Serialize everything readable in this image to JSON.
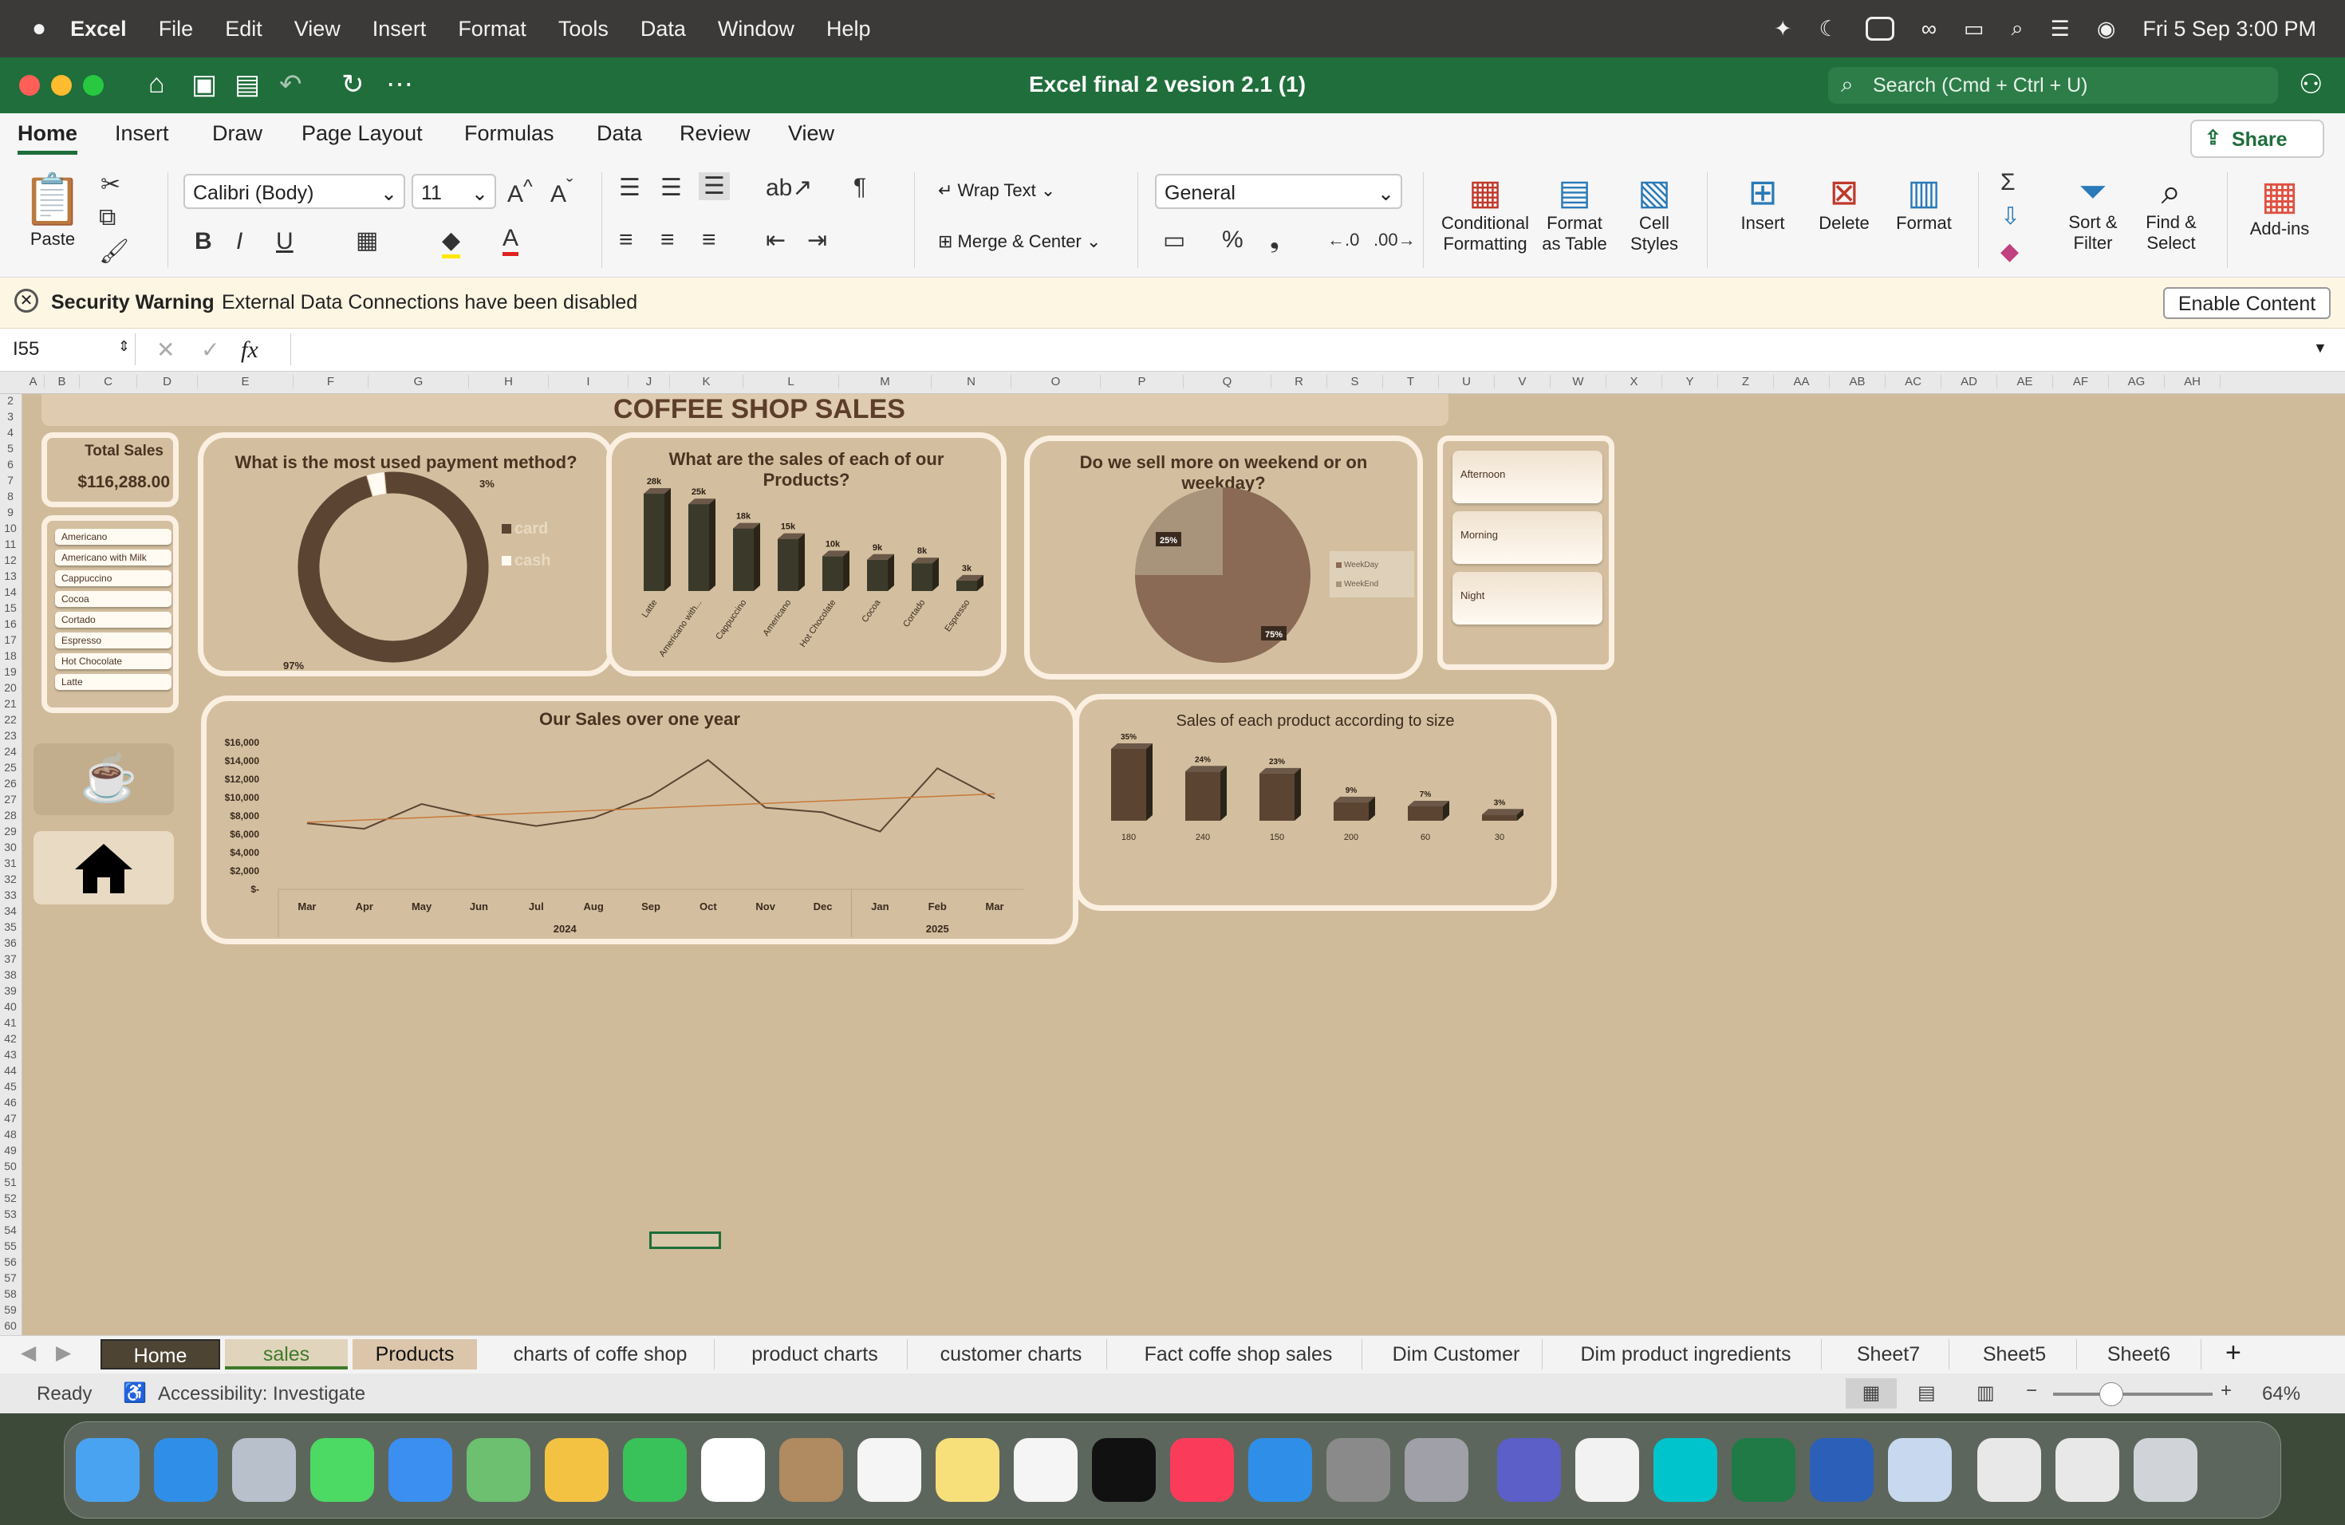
{
  "menubar": {
    "app": "Excel",
    "items": [
      "File",
      "Edit",
      "View",
      "Insert",
      "Format",
      "Tools",
      "Data",
      "Window",
      "Help"
    ],
    "datetime": "Fri 5 Sep  3:00 PM"
  },
  "window": {
    "title": "Excel final 2 vesion 2.1 (1)",
    "search_placeholder": "Search (Cmd + Ctrl + U)"
  },
  "ribbon": {
    "tabs": [
      "Home",
      "Insert",
      "Draw",
      "Page Layout",
      "Formulas",
      "Data",
      "Review",
      "View"
    ],
    "share": "Share",
    "paste": "Paste",
    "font_name": "Calibri (Body)",
    "font_size": "11",
    "wrap_text": "Wrap Text",
    "merge_center": "Merge & Center",
    "number_format": "General",
    "conditional": [
      "Conditional",
      "Formatting"
    ],
    "format_table": [
      "Format",
      "as Table"
    ],
    "cell_styles": [
      "Cell",
      "Styles"
    ],
    "insert": "Insert",
    "delete": "Delete",
    "format": "Format",
    "sort_filter": [
      "Sort &",
      "Filter"
    ],
    "find_select": [
      "Find &",
      "Select"
    ],
    "addins": "Add-ins"
  },
  "security": {
    "label": "Security Warning",
    "message": "External Data Connections have been disabled",
    "button": "Enable Content"
  },
  "formula_bar": {
    "cell_ref": "I55",
    "fx": "fx",
    "value": ""
  },
  "columns": [
    "A",
    "B",
    "C",
    "D",
    "E",
    "F",
    "G",
    "H",
    "I",
    "J",
    "K",
    "L",
    "M",
    "N",
    "O",
    "P",
    "Q",
    "R",
    "S",
    "T",
    "U",
    "V",
    "W",
    "X",
    "Y",
    "Z",
    "AA",
    "AB",
    "AC",
    "AD",
    "AE",
    "AF",
    "AG",
    "AH"
  ],
  "dashboard": {
    "title": "COFFEE SHOP SALES",
    "total_sales_label": "Total Sales",
    "total_sales_value": "$116,288.00",
    "product_slicer": [
      "Americano",
      "Americano with Milk",
      "Cappuccino",
      "Cocoa",
      "Cortado",
      "Espresso",
      "Hot Chocolate",
      "Latte"
    ],
    "time_slicer": [
      "Afternoon",
      "Morning",
      "Night"
    ]
  },
  "chart_data": [
    {
      "type": "pie",
      "title": "What is the most used payment method?",
      "categories": [
        "card",
        "cash"
      ],
      "values": [
        97,
        3
      ],
      "labels": [
        "97%",
        "3%"
      ],
      "colors": [
        "#5c4433",
        "#fffaf2"
      ],
      "legend": "right"
    },
    {
      "type": "bar",
      "title": "What are the sales of each of our Products?",
      "categories": [
        "Latte",
        "Americano with...",
        "Cappuccino",
        "Americano",
        "Hot Chocolate",
        "Cocoa",
        "Cortado",
        "Espresso"
      ],
      "values": [
        28,
        25,
        18,
        15,
        10,
        9,
        8,
        3
      ],
      "labels": [
        "28k",
        "25k",
        "18k",
        "15k",
        "10k",
        "9k",
        "8k",
        "3k"
      ],
      "color": "#3b3a2a"
    },
    {
      "type": "pie",
      "title": "Do we sell more on weekend or on weekday?",
      "categories": [
        "WeekDay",
        "WeekEnd"
      ],
      "values": [
        75,
        25
      ],
      "labels": [
        "75%",
        "25%"
      ],
      "colors": [
        "#8a6a55",
        "#a8947a"
      ],
      "legend": "right"
    },
    {
      "type": "line",
      "title": "Our Sales over one year",
      "categories": [
        "Mar",
        "Apr",
        "May",
        "Jun",
        "Jul",
        "Aug",
        "Sep",
        "Oct",
        "Nov",
        "Dec",
        "Jan",
        "Feb",
        "Mar"
      ],
      "groups": [
        {
          "label": "2024",
          "span": 10
        },
        {
          "label": "2025",
          "span": 3
        }
      ],
      "values": [
        7200,
        6600,
        9300,
        7900,
        6900,
        7800,
        10200,
        14100,
        8900,
        8400,
        6300,
        13200,
        9900
      ],
      "trend": [
        7300,
        10400
      ],
      "yticks": [
        "$-",
        "$2,000",
        "$4,000",
        "$6,000",
        "$8,000",
        "$10,000",
        "$12,000",
        "$14,000",
        "$16,000"
      ],
      "ylim": [
        0,
        16000
      ],
      "color": "#5c4433",
      "trend_color": "#c8783a"
    },
    {
      "type": "bar",
      "title": "Sales of each product according to size",
      "categories": [
        "180",
        "240",
        "150",
        "200",
        "60",
        "30"
      ],
      "values": [
        35,
        24,
        23,
        9,
        7,
        3
      ],
      "labels": [
        "35%",
        "24%",
        "23%",
        "9%",
        "7%",
        "3%"
      ],
      "color": "#5c4433"
    }
  ],
  "sheet_tabs": [
    "Home",
    "sales",
    "Products",
    "charts of coffe shop",
    "product charts",
    "customer charts",
    "Fact coffe shop sales",
    "Dim Customer",
    "Dim product ingredients",
    "Sheet7",
    "Sheet5",
    "Sheet6"
  ],
  "status": {
    "ready": "Ready",
    "accessibility": "Accessibility: Investigate",
    "zoom": "64%"
  }
}
